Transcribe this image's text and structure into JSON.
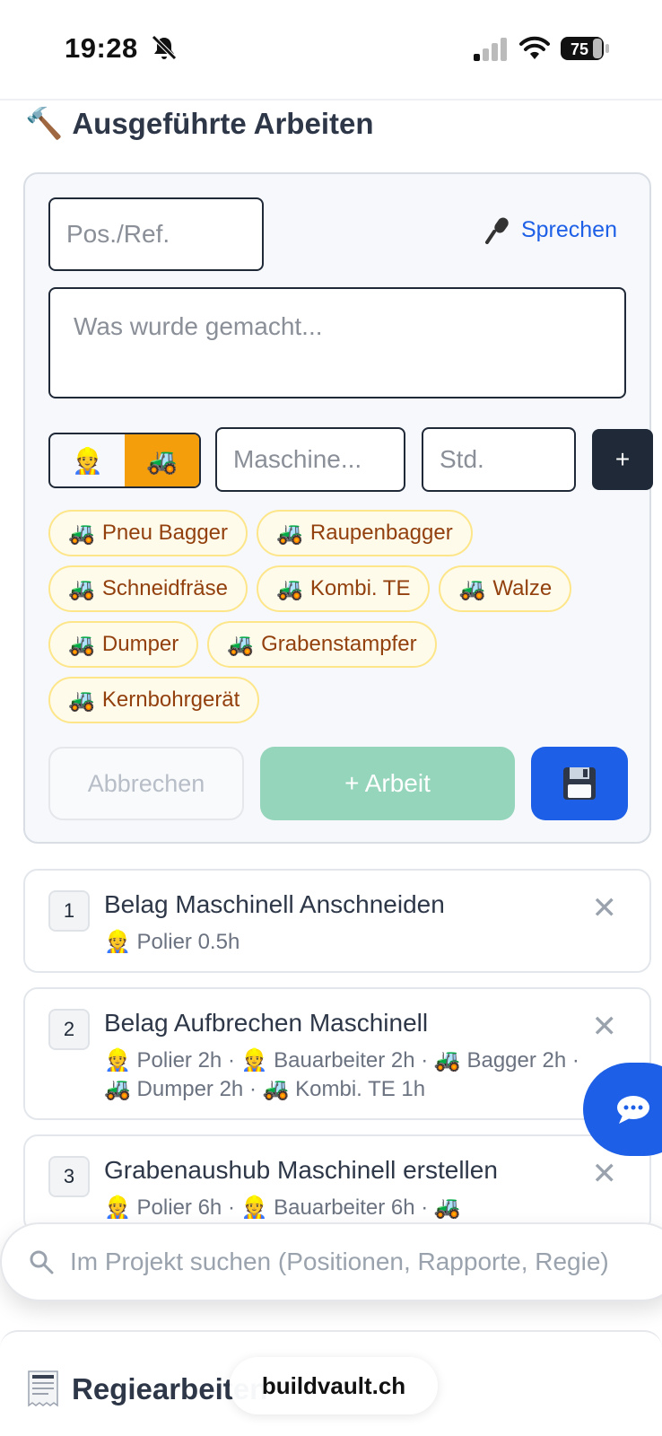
{
  "status_bar": {
    "time": "19:28",
    "battery": "75"
  },
  "section": {
    "title": "Ausgeführte Arbeiten",
    "icon": "hammer-icon"
  },
  "form": {
    "pos_placeholder": "Pos./Ref.",
    "speak_label": "Sprechen",
    "desc_placeholder": "Was wurde gemacht...",
    "toggle": {
      "worker_icon": "👷",
      "machine_icon": "🚜",
      "active": "machine"
    },
    "machine_placeholder": "Maschine...",
    "hours_placeholder": "Std.",
    "add_label": "+",
    "chips": [
      "Pneu Bagger",
      "Raupenbagger",
      "Schneidfräse",
      "Kombi. TE",
      "Walze",
      "Dumper",
      "Grabenstampfer",
      "Kernbohrgerät"
    ],
    "chip_icon": "🚜",
    "cancel_label": "Abbrechen",
    "add_work_label": "+ Arbeit",
    "save_icon": "floppy-disk-icon"
  },
  "items": [
    {
      "num": "1",
      "title": "Belag Maschinell Anschneiden",
      "detail": "👷 Polier 0.5h"
    },
    {
      "num": "2",
      "title": "Belag Aufbrechen Maschinell",
      "detail": "👷 Polier 2h · 👷 Bauarbeiter 2h · 🚜 Bagger 2h · 🚜 Dumper 2h · 🚜 Kombi. TE 1h"
    },
    {
      "num": "3",
      "title": "Grabenaushub Maschinell erstellen",
      "detail": "👷 Polier 6h · 👷 Bauarbeiter 6h · 🚜"
    }
  ],
  "search": {
    "placeholder": "Im Projekt suchen (Positionen, Rapporte, Regie)"
  },
  "bottom": {
    "title": "Regiearbeiten",
    "domain": "buildvault.ch"
  },
  "colors": {
    "primary": "#1d5fe6",
    "accent": "#f59e0b",
    "add_work": "#95d5bb",
    "dark": "#1f2937",
    "chip_text": "#92400e"
  }
}
